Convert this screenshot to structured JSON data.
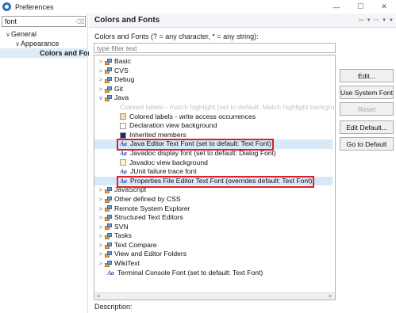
{
  "window": {
    "title": "Preferences",
    "minimize": "—",
    "maximize": "☐",
    "close": "✕"
  },
  "left": {
    "filter_value": "font",
    "tree": [
      {
        "label": "General",
        "toggle": "∨",
        "indent": 6
      },
      {
        "label": "Appearance",
        "toggle": "∨",
        "indent": 18
      },
      {
        "label": "Colors and Fonts",
        "toggle": "",
        "indent": 50,
        "selected": true
      }
    ]
  },
  "right": {
    "header": {
      "title": "Colors and Fonts"
    },
    "description": "Colors and Fonts (? = any character, * = any string):",
    "filter_placeholder": "type filter text",
    "tree": [
      {
        "kind": "category",
        "toggle": ">",
        "label": "Basic"
      },
      {
        "kind": "category",
        "toggle": ">",
        "label": "CVS"
      },
      {
        "kind": "category",
        "toggle": ">",
        "label": "Debug"
      },
      {
        "kind": "category",
        "toggle": ">",
        "label": "Git"
      },
      {
        "kind": "category",
        "toggle": "∨",
        "label": "Java"
      },
      {
        "kind": "faded",
        "label": "Colored labels - match highlight (set to default: Match highlight background"
      },
      {
        "kind": "color",
        "swatch": "#f7dfa4",
        "label": "Colored labels - write access occurrences"
      },
      {
        "kind": "color",
        "swatch": "#ffffff",
        "label": "Declaration view background"
      },
      {
        "kind": "color",
        "swatch": "#1f2a78",
        "label": "Inherited members"
      },
      {
        "kind": "font",
        "label": "Java Editor Text Font (set to default: Text Font)",
        "highlight": true
      },
      {
        "kind": "font",
        "label": "Javadoc display font (set to default: Dialog Font)"
      },
      {
        "kind": "color",
        "swatch": "#fff4c0",
        "label": "Javadoc view background"
      },
      {
        "kind": "font",
        "label": "JUnit failure trace font"
      },
      {
        "kind": "font",
        "label": "Properties File Editor Text Font (overrides default: Text Font)",
        "highlight": true
      },
      {
        "kind": "category",
        "toggle": ">",
        "label": "JavaScript"
      },
      {
        "kind": "category",
        "toggle": ">",
        "label": "Other defined by CSS"
      },
      {
        "kind": "category",
        "toggle": ">",
        "label": "Remote System Explorer"
      },
      {
        "kind": "category",
        "toggle": ">",
        "label": "Structured Text Editors"
      },
      {
        "kind": "category",
        "toggle": ">",
        "label": "SVN"
      },
      {
        "kind": "category",
        "toggle": ">",
        "label": "Tasks"
      },
      {
        "kind": "category",
        "toggle": ">",
        "label": "Text Compare"
      },
      {
        "kind": "category",
        "toggle": ">",
        "label": "View and Editor Folders"
      },
      {
        "kind": "category",
        "toggle": ">",
        "label": "WikiText"
      },
      {
        "kind": "font-top",
        "label": "Terminal Console Font (set to default: Text Font)"
      }
    ],
    "scroll_left": "<",
    "scroll_right": ">",
    "buttons": {
      "edit": "Edit...",
      "use_system_font": "Use System Font",
      "reset": "Reset",
      "edit_default": "Edit Default...",
      "go_to_default": "Go to Default"
    },
    "description_label": "Description:"
  }
}
